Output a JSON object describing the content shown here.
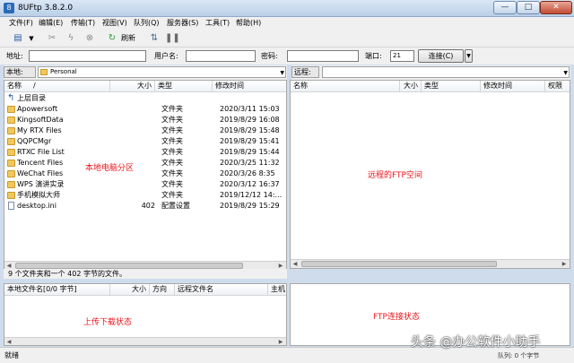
{
  "window": {
    "title": "8UFtp 3.8.2.0",
    "min": "—",
    "max": "□",
    "close": "✕"
  },
  "menu": [
    "文件(F)",
    "编辑(E)",
    "传输(T)",
    "视图(V)",
    "队列(Q)",
    "服务器(S)",
    "工具(T)",
    "帮助(H)"
  ],
  "toolbar": {
    "refresh_label": "刷新"
  },
  "connect": {
    "address_label": "地址:",
    "address_value": "",
    "user_label": "用户名:",
    "user_value": "",
    "password_label": "密码:",
    "password_value": "",
    "port_label": "端口:",
    "port_value": "21",
    "connect_button": "连接(C)"
  },
  "local": {
    "path_label": "本地:",
    "path_value": "Personal",
    "columns": {
      "name": "名称",
      "sort": "/",
      "size": "大小",
      "type": "类型",
      "modified": "修改时间"
    },
    "parent_dir": "上层目录",
    "files": [
      {
        "name": "Apowersoft",
        "size": "",
        "type": "文件夹",
        "modified": "2020/3/11 15:03",
        "icon": "folder-icon"
      },
      {
        "name": "KingsoftData",
        "size": "",
        "type": "文件夹",
        "modified": "2019/8/29 16:08",
        "icon": "folder-icon"
      },
      {
        "name": "My RTX Files",
        "size": "",
        "type": "文件夹",
        "modified": "2019/8/29 15:48",
        "icon": "folder-icon"
      },
      {
        "name": "QQPCMgr",
        "size": "",
        "type": "文件夹",
        "modified": "2019/8/29 15:41",
        "icon": "folder-icon"
      },
      {
        "name": "RTXC File List",
        "size": "",
        "type": "文件夹",
        "modified": "2019/8/29 15:44",
        "icon": "folder-icon"
      },
      {
        "name": "Tencent Files",
        "size": "",
        "type": "文件夹",
        "modified": "2020/3/25 11:32",
        "icon": "folder-icon"
      },
      {
        "name": "WeChat Files",
        "size": "",
        "type": "文件夹",
        "modified": "2020/3/26 8:35",
        "icon": "folder-icon"
      },
      {
        "name": "WPS 演讲实录",
        "size": "",
        "type": "文件夹",
        "modified": "2020/3/12 16:37",
        "icon": "folder-icon"
      },
      {
        "name": "手机模拟大师",
        "size": "",
        "type": "文件夹",
        "modified": "2019/12/12 14:...",
        "icon": "folder-icon"
      },
      {
        "name": "desktop.ini",
        "size": "402",
        "type": "配置设置",
        "modified": "2019/8/29 15:29",
        "icon": "file-icon"
      }
    ],
    "annotation": "本地电脑分区",
    "status": "9 个文件夹和一个 402 字节的文件。"
  },
  "remote": {
    "path_label": "远程:",
    "path_value": "",
    "columns": {
      "name": "名称",
      "size": "大小",
      "type": "类型",
      "modified": "修改时间",
      "perm": "权限"
    },
    "annotation": "远程的FTP空间"
  },
  "queue": {
    "columns": {
      "local_name": "本地文件名[0/0 字节]",
      "size": "大小",
      "direction": "方向",
      "remote_name": "远程文件名",
      "host": "主机"
    },
    "annotation": "上传下载状态"
  },
  "ftp_log": {
    "annotation": "FTP连接状态"
  },
  "statusbar": {
    "status": "就绪",
    "queue": "队列: 0 个字节"
  },
  "watermark": "头条 @办公软件小助手"
}
